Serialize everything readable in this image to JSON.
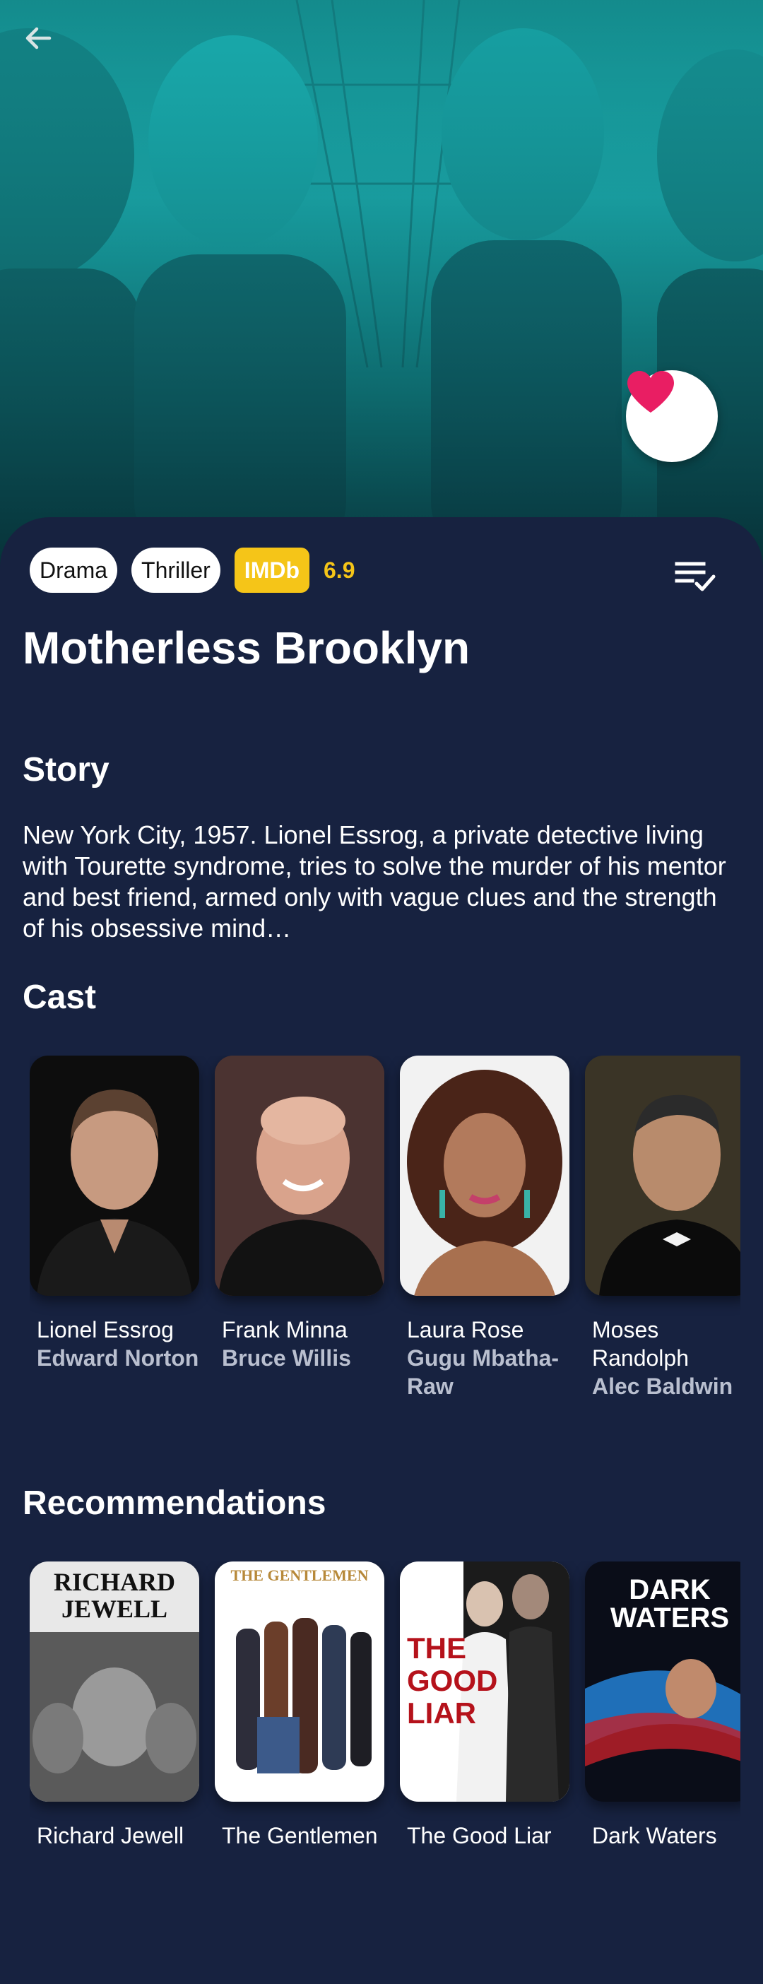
{
  "app": {
    "accent": "#f5c518",
    "background": "#172240",
    "favorite_color": "#e91e63"
  },
  "toolbar": {
    "back_icon": "arrow-back-icon"
  },
  "hero": {
    "favorite_icon": "heart-icon"
  },
  "movie": {
    "genres": [
      "Drama",
      "Thriller"
    ],
    "imdb_label": "IMDb",
    "rating": "6.9",
    "watchlist_icon": "playlist-check-icon",
    "title": "Motherless Brooklyn"
  },
  "story": {
    "heading": "Story",
    "text": "New York City, 1957. Lionel Essrog, a private detective living with Tourette syndrome, tries to solve the murder of his mentor and best friend, armed only with vague clues and the strength of his obsessive mind…"
  },
  "cast": {
    "heading": "Cast",
    "items": [
      {
        "character": "Lionel Essrog",
        "actor": "Edward Norton"
      },
      {
        "character": "Frank Minna",
        "actor": "Bruce Willis"
      },
      {
        "character": "Laura Rose",
        "actor": "Gugu Mbatha-Raw"
      },
      {
        "character": "Moses Randolph",
        "actor": "Alec Baldwin"
      }
    ]
  },
  "recommendations": {
    "heading": "Recommendations",
    "items": [
      {
        "title": "Richard Jewell",
        "poster_text": "RICHARD JEWELL"
      },
      {
        "title": "The Gentlemen",
        "poster_text": "THE GENTLEMEN"
      },
      {
        "title": "The Good Liar",
        "poster_text": "THE GOOD LIAR"
      },
      {
        "title": "Dark Waters",
        "poster_text": "DARK WATERS"
      }
    ]
  }
}
